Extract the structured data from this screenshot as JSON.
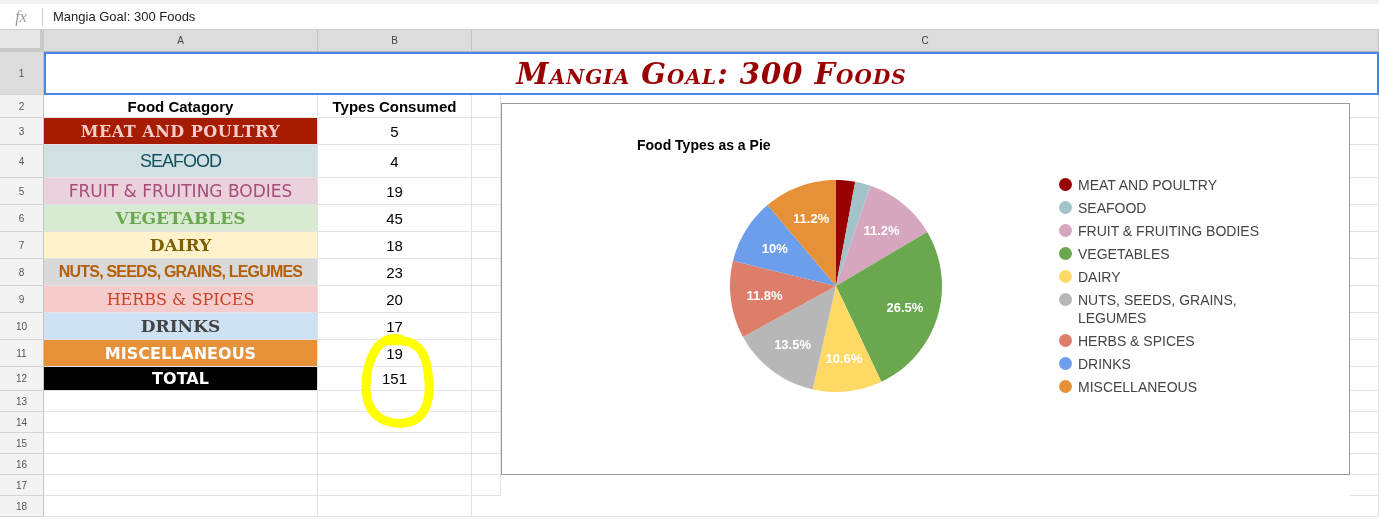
{
  "formula_bar": {
    "label": "fx",
    "value": "Mangia Goal: 300 Foods"
  },
  "columns": [
    "A",
    "B",
    "C"
  ],
  "row_numbers": [
    "1",
    "2",
    "3",
    "4",
    "5",
    "6",
    "7",
    "8",
    "9",
    "10",
    "11",
    "12",
    "13",
    "14",
    "15",
    "16",
    "17",
    "18"
  ],
  "title": "Mangia Goal: 300 Foods",
  "headers": [
    "Food Catagory",
    "Types Consumed"
  ],
  "rows": [
    {
      "category": "MEAT AND POULTRY",
      "count": "5",
      "color": "#a61c00",
      "kind": "meat"
    },
    {
      "category": "SEAFOOD",
      "count": "4",
      "color": "#d0e0e3",
      "kind": "seafood"
    },
    {
      "category": "FRUIT & FRUITING BODIES",
      "count": "19",
      "color": "#ead1dc",
      "kind": "fruit"
    },
    {
      "category": "VEGETABLES",
      "count": "45",
      "color": "#d9ead3",
      "kind": "vegetables"
    },
    {
      "category": "DAIRY",
      "count": "18",
      "color": "#fff2cc",
      "kind": "dairy"
    },
    {
      "category": "NUTS, SEEDS, GRAINS, LEGUMES",
      "count": "23",
      "color": "#d9d9d9",
      "kind": "nuts"
    },
    {
      "category": "HERBS & SPICES",
      "count": "20",
      "color": "#f4cccc",
      "kind": "herbs"
    },
    {
      "category": "DRINKS",
      "count": "17",
      "color": "#cfe2f3",
      "kind": "drinks"
    },
    {
      "category": "MISCELLANEOUS",
      "count": "19",
      "color": "#e69138",
      "kind": "misc"
    },
    {
      "category": "TOTAL",
      "count": "151",
      "color": "#000000",
      "kind": "total"
    }
  ],
  "chart": {
    "chart_data": {
      "type": "pie",
      "title": "Food Types as a Pie",
      "categories": [
        "MEAT AND POULTRY",
        "SEAFOOD",
        "FRUIT & FRUITING BODIES",
        "VEGETABLES",
        "DAIRY",
        "NUTS, SEEDS, GRAINS, LEGUMES",
        "HERBS & SPICES",
        "DRINKS",
        "MISCELLANEOUS"
      ],
      "values": [
        2.9,
        2.4,
        11.2,
        26.5,
        10.6,
        13.5,
        11.8,
        10,
        11.2
      ],
      "legend": "right",
      "colors": [
        "#990000",
        "#a2c4c9",
        "#d5a6bd",
        "#6aa84f",
        "#ffd966",
        "#b7b7b7",
        "#dd7e6b",
        "#6d9eeb",
        "#e69138"
      ],
      "data_labels": true,
      "value_labels": [
        null,
        null,
        "11.2%",
        "26.5%",
        "10.6%",
        "13.5%",
        "11.8%",
        "10%",
        "11.2%"
      ]
    }
  }
}
